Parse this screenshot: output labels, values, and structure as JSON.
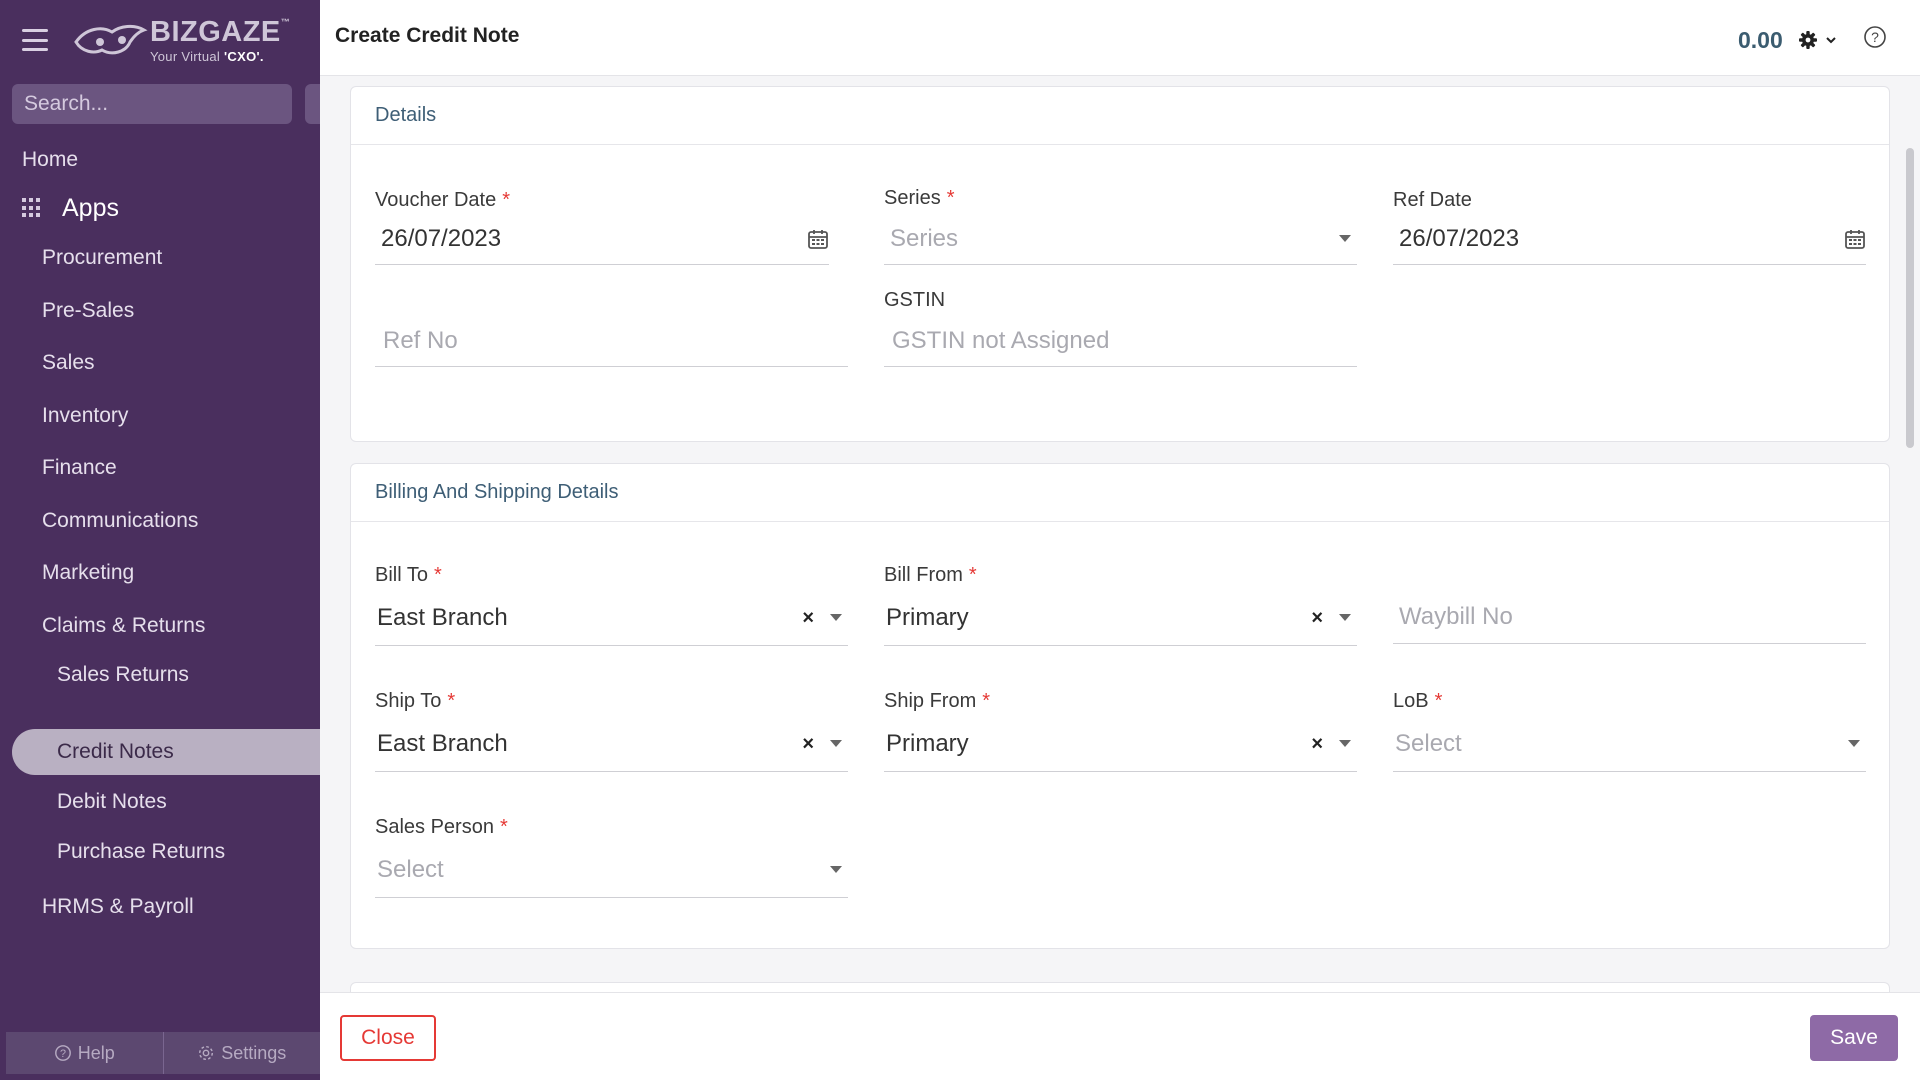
{
  "sidebar": {
    "logo": {
      "name": "BIZGAZE",
      "tm": "™",
      "tagline_prefix": "Your Virtual ",
      "tagline_bold": "'CXO'."
    },
    "search_placeholder": "Search...",
    "home": "Home",
    "apps": "Apps",
    "items": [
      {
        "label": "Procurement"
      },
      {
        "label": "Pre-Sales"
      },
      {
        "label": "Sales"
      },
      {
        "label": "Inventory"
      },
      {
        "label": "Finance"
      },
      {
        "label": "Communications"
      },
      {
        "label": "Marketing"
      },
      {
        "label": "Claims & Returns"
      },
      {
        "label": "Sales Returns"
      },
      {
        "label": "Credit Notes"
      },
      {
        "label": "Debit Notes"
      },
      {
        "label": "Purchase Returns"
      },
      {
        "label": "HRMS & Payroll"
      }
    ],
    "active_item": "Credit Notes",
    "bottom": {
      "help": "Help",
      "settings": "Settings"
    }
  },
  "header": {
    "title": "Create Credit Note",
    "amount": "0.00",
    "icons": [
      "gear-icon",
      "chevron-down-icon",
      "help-circle-icon"
    ]
  },
  "details": {
    "heading": "Details",
    "voucher_date": {
      "label": "Voucher Date",
      "value": "26/07/2023"
    },
    "series": {
      "label": "Series",
      "placeholder": "Series"
    },
    "ref_date": {
      "label": "Ref Date",
      "value": "26/07/2023"
    },
    "ref_no": {
      "placeholder": "Ref No"
    },
    "gstin": {
      "label": "GSTIN",
      "placeholder": "GSTIN not Assigned"
    }
  },
  "billing": {
    "heading": "Billing And Shipping Details",
    "bill_to": {
      "label": "Bill To",
      "value": "East Branch"
    },
    "bill_from": {
      "label": "Bill From",
      "value": "Primary"
    },
    "waybill_no": {
      "placeholder": "Waybill No"
    },
    "ship_to": {
      "label": "Ship To",
      "value": "East Branch"
    },
    "ship_from": {
      "label": "Ship From",
      "value": "Primary"
    },
    "lob": {
      "label": "LoB",
      "placeholder": "Select"
    },
    "sales_person": {
      "label": "Sales Person",
      "placeholder": "Select"
    },
    "clear_glyph": "×"
  },
  "footer": {
    "close": "Close",
    "save": "Save"
  },
  "colors": {
    "sidebar_bg": "#4a2f5e",
    "accent": "#8e6aa6",
    "danger": "#e53935",
    "section_heading": "#3e5e76"
  }
}
